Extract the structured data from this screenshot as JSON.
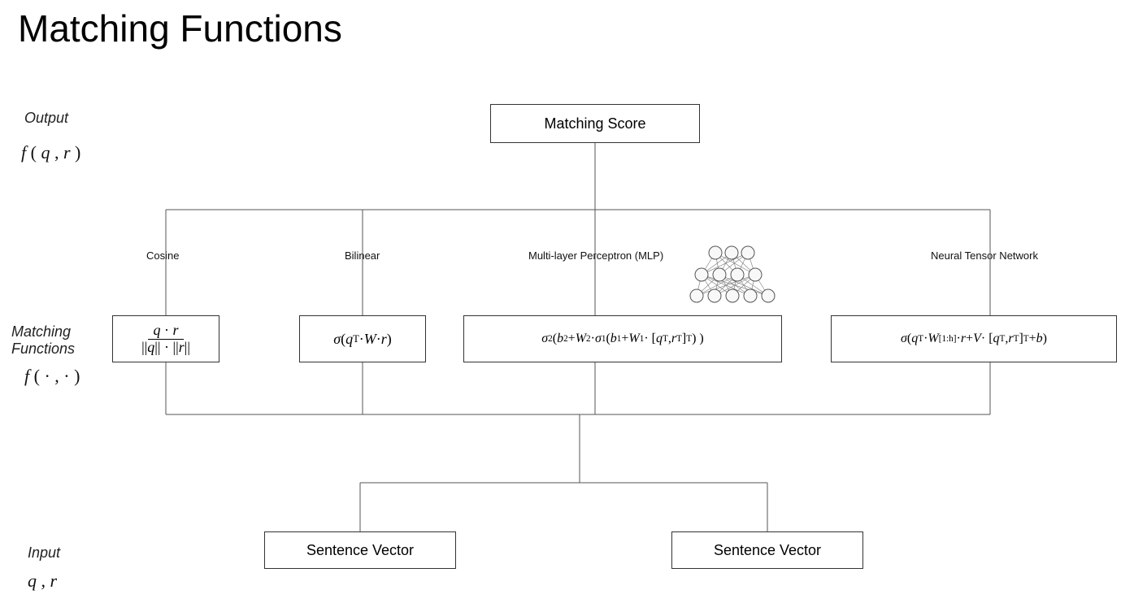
{
  "title": "Matching Functions",
  "rows": {
    "output": {
      "label": "Output",
      "formula_html": "f ( q , r )"
    },
    "functions": {
      "label": "Matching\nFunctions",
      "formula_html": "f ( · , · )"
    },
    "input": {
      "label": "Input",
      "formula_html": "q , r"
    }
  },
  "output_box": "Matching Score",
  "branches": [
    {
      "label": "Cosine",
      "formula_html": "<span class='frac'><span class='num'><i>q</i> · <i>r</i></span><span class='den'>||<i>q</i>|| · ||<i>r</i>||</span></span>"
    },
    {
      "label": "Bilinear",
      "formula_html": "<i>σ</i>( <i>q</i><span class='sup'>T</span> · <i>W</i> · <i>r</i> )"
    },
    {
      "label": "Multi-layer Perceptron (MLP)",
      "formula_html": "<i>σ</i><span class='sub'>2</span>( <i>b</i><span class='sub'>2</span> + <i>W</i><span class='sub'>2</span> · <i>σ</i><span class='sub'>1</span>( <i>b</i><span class='sub'>1</span> + <i>W</i><span class='sub'>1</span> · [ <i>q</i><span class='sup'>T</span> , <i>r</i><span class='sup'>T</span> ]<span class='sup'>T</span> ) )"
    },
    {
      "label": "Neural Tensor Network",
      "formula_html": "<i>σ</i>( <i>q</i><span class='sup'>T</span> · <i>W</i><span class='sup'>[1:h]</span>· <i>r</i> + <i>V</i> · [ <i>q</i><span class='sup'>T</span> , <i>r</i><span class='sup'>T</span> ]<span class='sup'>T</span> + <i>b</i> )"
    }
  ],
  "inputs": [
    {
      "label": "Sentence Vector"
    },
    {
      "label": "Sentence Vector"
    }
  ]
}
